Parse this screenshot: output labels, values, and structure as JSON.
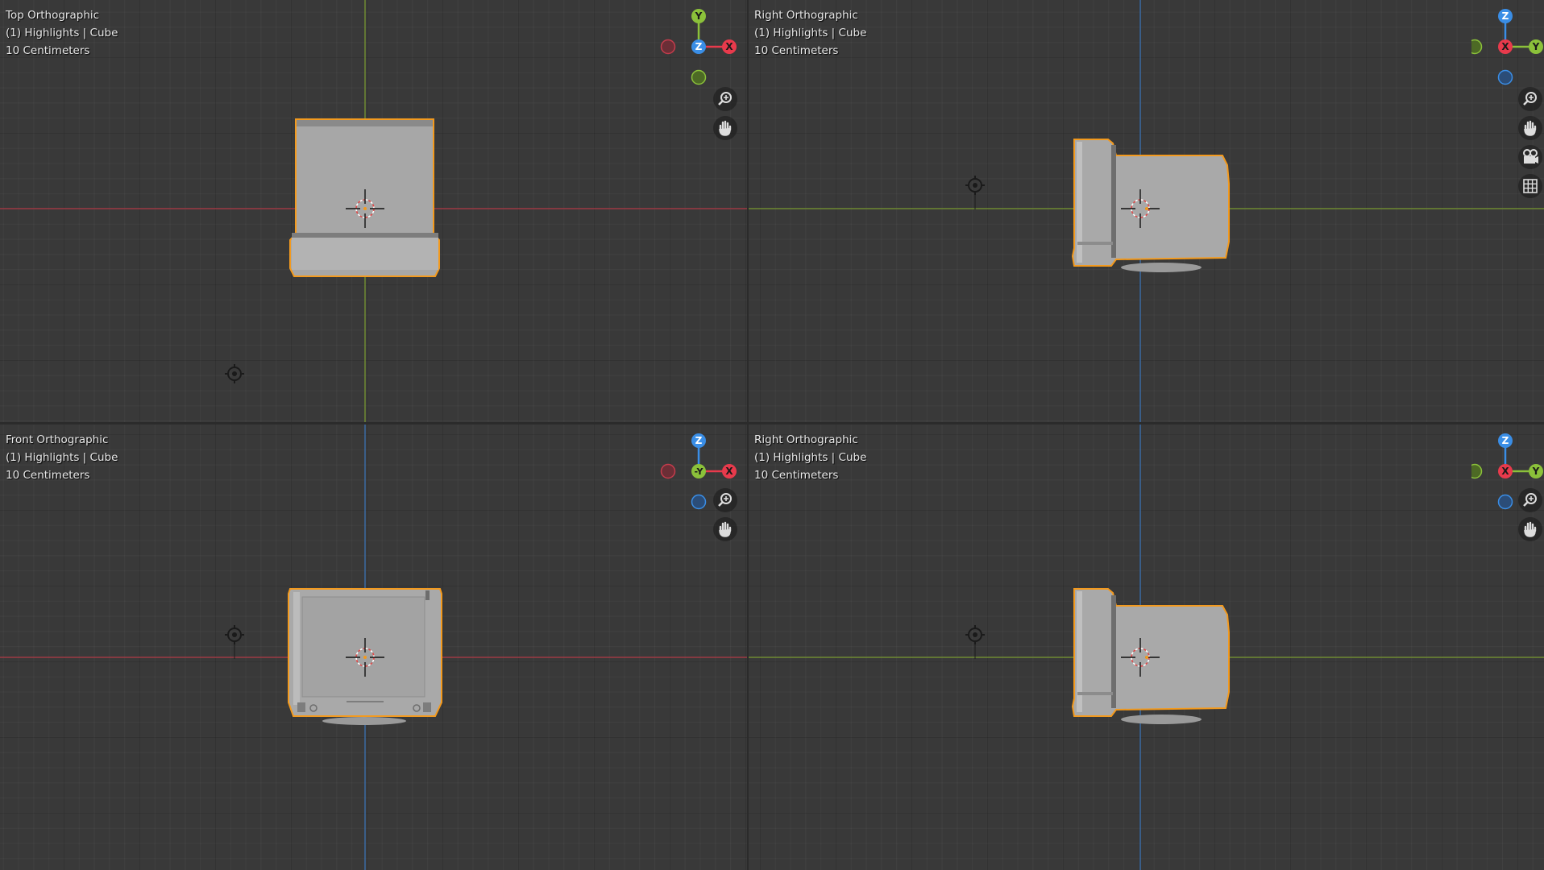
{
  "viewports": {
    "top_left": {
      "view_name": "Top Orthographic",
      "object_info": "(1) Highlights | Cube",
      "scale": "10 Centimeters",
      "gizmo": {
        "center": "Z",
        "up": "Y",
        "right": "X"
      }
    },
    "top_right": {
      "view_name": "Right Orthographic",
      "object_info": "(1) Highlights | Cube",
      "scale": "10 Centimeters",
      "gizmo": {
        "center": "X",
        "up": "Z",
        "right": "Y"
      }
    },
    "bottom_left": {
      "view_name": "Front Orthographic",
      "object_info": "(1) Highlights | Cube",
      "scale": "10 Centimeters",
      "gizmo": {
        "center": "-Y",
        "up": "Z",
        "right": "X"
      }
    },
    "bottom_right": {
      "view_name": "Right Orthographic",
      "object_info": "(1) Highlights | Cube",
      "scale": "10 Centimeters",
      "gizmo": {
        "center": "X",
        "up": "Z",
        "right": "Y"
      }
    }
  },
  "navigation_tools": [
    "zoom-icon",
    "pan-hand-icon",
    "camera-view-icon",
    "perspective-grid-icon"
  ],
  "colors": {
    "viewport_bg": "#393939",
    "x_axis": "#e83a4c",
    "y_axis": "#8bc13a",
    "z_axis": "#3a8ee6",
    "selection_outline": "#f39a1e",
    "object_fill": "#a8a8a8"
  }
}
